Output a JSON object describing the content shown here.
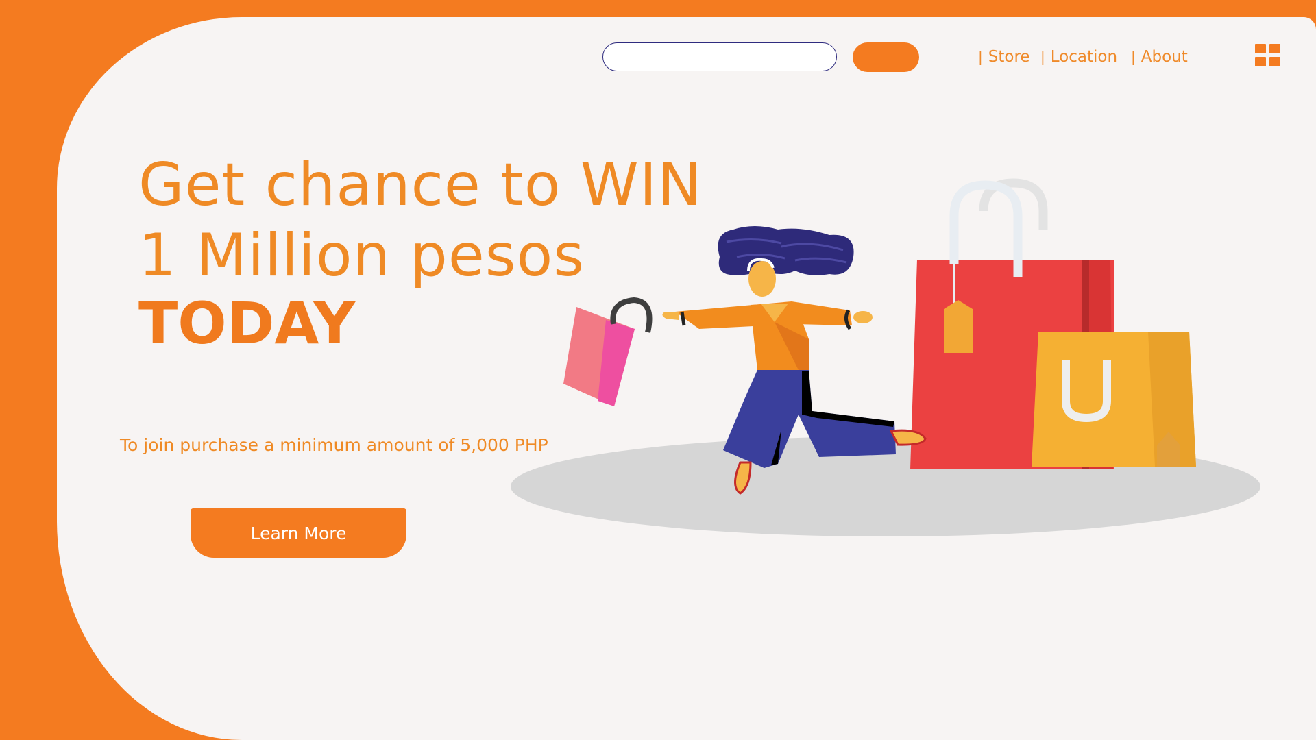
{
  "header": {
    "search": {
      "value": "",
      "placeholder": ""
    },
    "search_button_label": "",
    "nav": [
      {
        "separator": "|",
        "label": "Store"
      },
      {
        "separator": "|",
        "label": "Location"
      },
      {
        "separator": "|",
        "label": "About"
      }
    ],
    "menu_icon": "grid-icon"
  },
  "hero": {
    "line1": "Get chance to WIN",
    "line2": "1 Million pesos",
    "line3": "TODAY",
    "subtext": "To join purchase a minimum amount of 5,000 PHP",
    "cta_label": "Learn More"
  },
  "illustration": {
    "subject": "woman running with shopping bags",
    "icons": [
      "shopping-bag-icon",
      "price-tag-icon"
    ]
  },
  "colors": {
    "accent": "#f47b20",
    "text_accent": "#ef8a25",
    "panel": "#f7f4f3",
    "search_border": "#2f2c7f"
  }
}
